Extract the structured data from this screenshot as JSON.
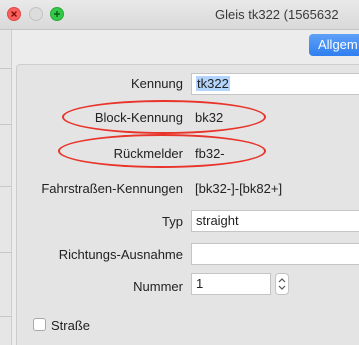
{
  "window": {
    "title": "Gleis tk322 (1565632"
  },
  "tabs": {
    "active_label": "Allgem"
  },
  "form": {
    "kennung": {
      "label": "Kennung",
      "value": "tk322"
    },
    "block_kennung": {
      "label": "Block-Kennung",
      "value": "bk32"
    },
    "rueckmelder": {
      "label": "Rückmelder",
      "value": "fb32-"
    },
    "fahrstrassen": {
      "label": "Fahrstraßen-Kennungen",
      "value": "[bk32-]-[bk82+]"
    },
    "typ": {
      "label": "Typ",
      "value": "straight"
    },
    "richtungs_ausnahme": {
      "label": "Richtungs-Ausnahme",
      "value": ""
    },
    "nummer": {
      "label": "Nummer",
      "value": "1"
    },
    "strasse": {
      "label": "Straße",
      "checked": false
    }
  },
  "annotations": {
    "highlight_color": "#e8342a"
  }
}
